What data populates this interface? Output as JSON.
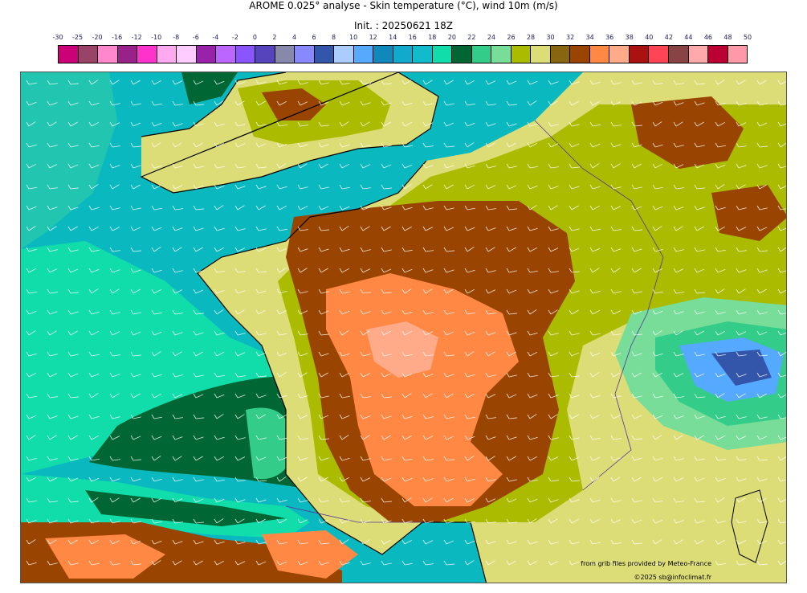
{
  "header": {
    "title": "AROME 0.025° analyse - Skin temperature (°C), wind 10m (m/s)",
    "init": "Init. : 20250621 18Z"
  },
  "colorbar": {
    "ticks": [
      "-30",
      "-25",
      "-20",
      "-16",
      "-12",
      "-10",
      "-8",
      "-6",
      "-4",
      "-2",
      "0",
      "2",
      "4",
      "6",
      "8",
      "10",
      "12",
      "14",
      "16",
      "18",
      "20",
      "22",
      "24",
      "26",
      "28",
      "30",
      "32",
      "34",
      "36",
      "38",
      "40",
      "42",
      "44",
      "46",
      "48",
      "50"
    ],
    "colors": [
      "#cc0077",
      "#994466",
      "#ff88cc",
      "#992288",
      "#ff33cc",
      "#ffaaee",
      "#ffccff",
      "#9922aa",
      "#bb66ff",
      "#8855ff",
      "#5544bb",
      "#8888aa",
      "#8888ff",
      "#3355aa",
      "#aaccff",
      "#55aaff",
      "#1188bb",
      "#11aacc",
      "#11bbcc",
      "#11ddaa",
      "#006633",
      "#33cc88",
      "#77dd99",
      "#aabb00",
      "#dddd77",
      "#886611",
      "#994400",
      "#ff8844",
      "#ffaa88",
      "#aa1111",
      "#ff4455",
      "#884444",
      "#ffaaaa",
      "#bb0033",
      "#ff99aa"
    ]
  },
  "map": {
    "sea_color": "#0ab8c0",
    "layers": {
      "hot_land": "#994400",
      "very_hot": "#ff8844",
      "warm_land": "#aabb00",
      "mild_land": "#dddd77",
      "cool_land": "#77dd99",
      "cold_sea": "#006633",
      "alps": "#3355aa"
    }
  },
  "credits": {
    "source": "from grib files provided by Meteo-France",
    "author": "©2025 sb@infoclimat.fr"
  }
}
